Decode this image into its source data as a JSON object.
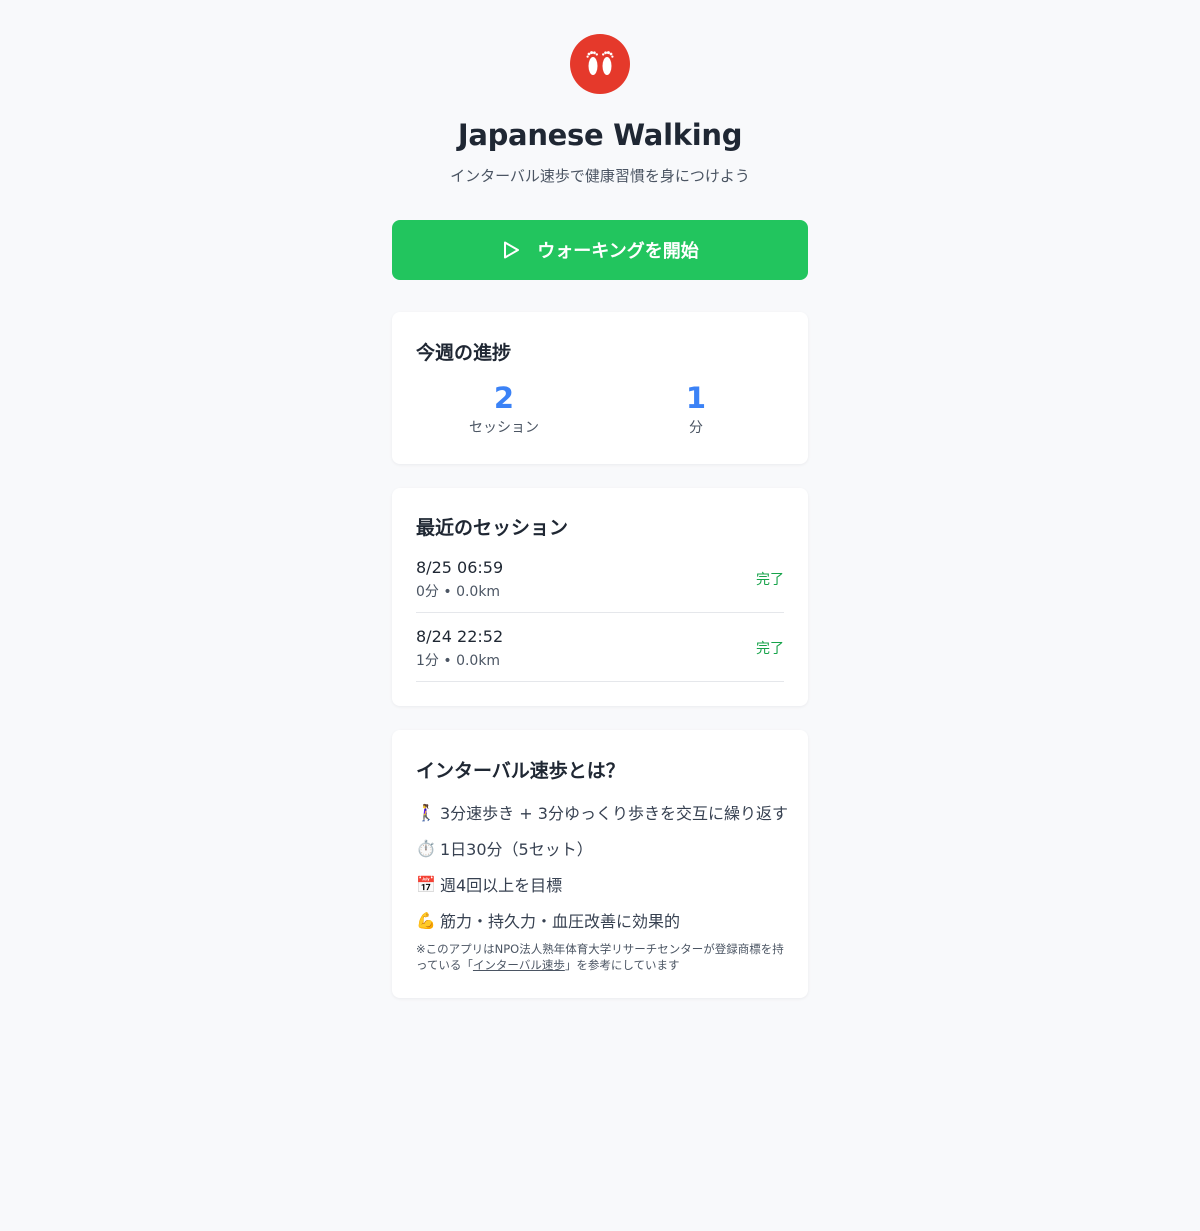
{
  "app": {
    "title": "Japanese Walking",
    "subtitle": "インターバル速歩で健康習慣を身につけよう",
    "logo_icon": "footprints-icon"
  },
  "start_button": {
    "label": "ウォーキングを開始",
    "icon": "play-icon"
  },
  "weekly_progress": {
    "title": "今週の進捗",
    "sessions": {
      "value": "2",
      "label": "セッション"
    },
    "minutes": {
      "value": "1",
      "label": "分"
    }
  },
  "recent_sessions": {
    "title": "最近のセッション",
    "items": [
      {
        "date": "8/25 06:59",
        "detail": "0分 • 0.0km",
        "status": "完了"
      },
      {
        "date": "8/24 22:52",
        "detail": "1分 • 0.0km",
        "status": "完了"
      }
    ]
  },
  "about": {
    "title": "インターバル速歩とは？",
    "items": [
      {
        "emoji": "🚶‍♀️",
        "icon": "walking-person-icon",
        "text": "3分速歩き + 3分ゆっくり歩きを交互に繰り返す"
      },
      {
        "emoji": "⏱️",
        "icon": "stopwatch-icon",
        "text": "1日30分（5セット）"
      },
      {
        "emoji": "📅",
        "icon": "calendar-icon",
        "text": "週4回以上を目標"
      },
      {
        "emoji": "💪",
        "icon": "flexed-biceps-icon",
        "text": "筋力・持久力・血圧改善に効果的"
      }
    ],
    "note_before": "※このアプリはNPO法人熟年体育大学リサーチセンターが登録商標を持っている「",
    "note_link": "インターバル速歩",
    "note_after": "」を参考にしています"
  },
  "colors": {
    "background": "#f8f9fb",
    "logo": "#e5392b",
    "start_button": "#22c55e",
    "stat_value": "#3b82f6",
    "status_complete": "#16a34a"
  }
}
